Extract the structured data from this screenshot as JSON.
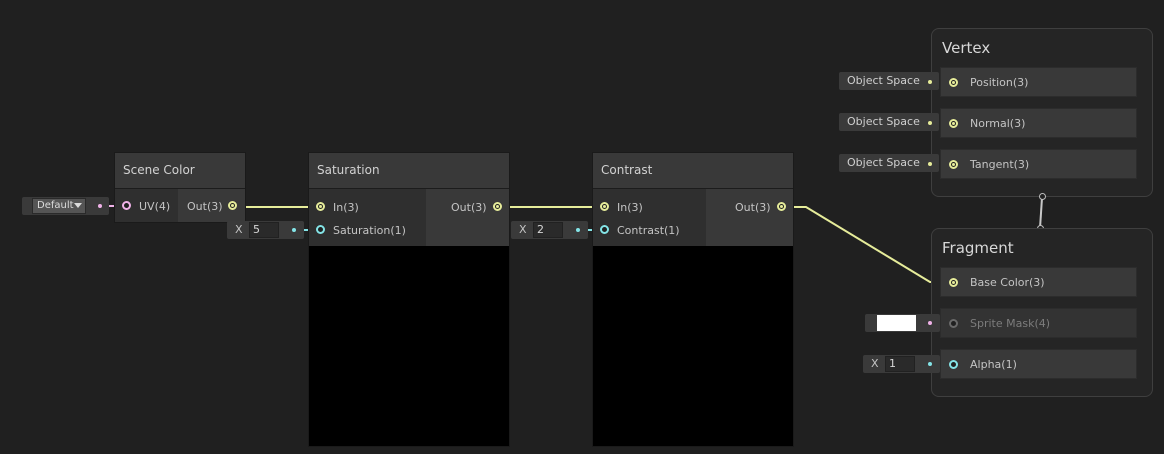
{
  "nodes": {
    "scene_color": {
      "title": "Scene Color",
      "input": "UV(4)",
      "output": "Out(3)",
      "uv_mode": "Default"
    },
    "saturation": {
      "title": "Saturation",
      "inputs": [
        "In(3)",
        "Saturation(1)"
      ],
      "output": "Out(3)",
      "field_label": "X",
      "field_value": "5"
    },
    "contrast": {
      "title": "Contrast",
      "inputs": [
        "In(3)",
        "Contrast(1)"
      ],
      "output": "Out(3)",
      "field_label": "X",
      "field_value": "2"
    }
  },
  "master": {
    "vertex": {
      "title": "Vertex",
      "blocks": [
        {
          "label": "Position(3)",
          "space": "Object Space"
        },
        {
          "label": "Normal(3)",
          "space": "Object Space"
        },
        {
          "label": "Tangent(3)",
          "space": "Object Space"
        }
      ]
    },
    "fragment": {
      "title": "Fragment",
      "blocks": [
        {
          "label": "Base Color(3)"
        },
        {
          "label": "Sprite Mask(4)",
          "color_value": "#ffffff"
        },
        {
          "label": "Alpha(1)",
          "field_label": "X",
          "field_value": "1"
        }
      ]
    }
  },
  "colors": {
    "background": "#202020",
    "vector3_port": "#e6ec9a",
    "float_port": "#84e4e7",
    "vector4_port": "#f0b2e8"
  }
}
